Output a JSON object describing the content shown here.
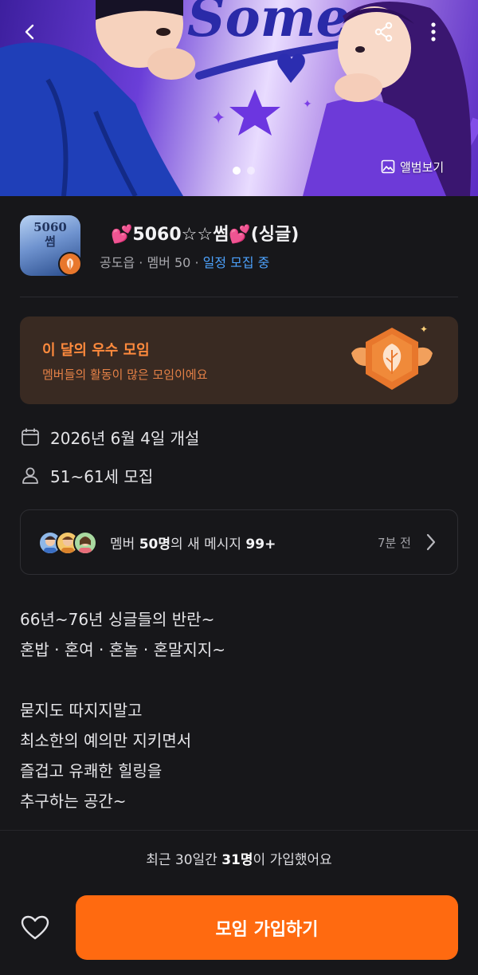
{
  "header": {
    "hero_logo_text": "Some",
    "album_label": "앨범보기",
    "carousel": {
      "count": 2,
      "active": 0
    }
  },
  "club": {
    "thumb_text_top": "5060",
    "thumb_text_bottom": "썸",
    "name": "💕5060☆☆썸💕(싱글)",
    "location": "공도읍",
    "member_label": "멤버 50",
    "status": "일정 모집 중",
    "dot_sep": "·"
  },
  "award": {
    "title": "이 달의 우수 모임",
    "subtitle": "멤버들의 활동이 많은 모임이에요"
  },
  "info": {
    "founded": "2026년 6월 4일 개설",
    "age_range": "51~61세 모집"
  },
  "messages": {
    "prefix": "멤버 ",
    "member_count": "50명",
    "middle": "의 새 메시지 ",
    "new_count": "99+",
    "time": "7분 전"
  },
  "description": "66년~76년  싱글들의 반란~\n혼밥 · 혼여 · 혼놀 · 혼말지지~\n\n묻지도  따지지말고\n최소한의 예의만 지키면서\n즐겁고 유쾌한 힐링을\n추구하는 공간~",
  "recent": {
    "prefix": "최근 30일간 ",
    "count": "31명",
    "suffix": "이 가입했어요"
  },
  "bottom": {
    "join_label": "모임 가입하기"
  },
  "colors": {
    "accent": "#ff6a10",
    "status_blue": "#4da3ff",
    "award_bg": "#392a22",
    "award_text": "#ff8a3d",
    "background": "#17171a"
  },
  "icons": [
    "back-icon",
    "share-icon",
    "more-icon",
    "image-icon",
    "calendar-icon",
    "person-icon",
    "chevron-right-icon",
    "heart-icon",
    "leaf-badge-icon",
    "medal-icon"
  ]
}
